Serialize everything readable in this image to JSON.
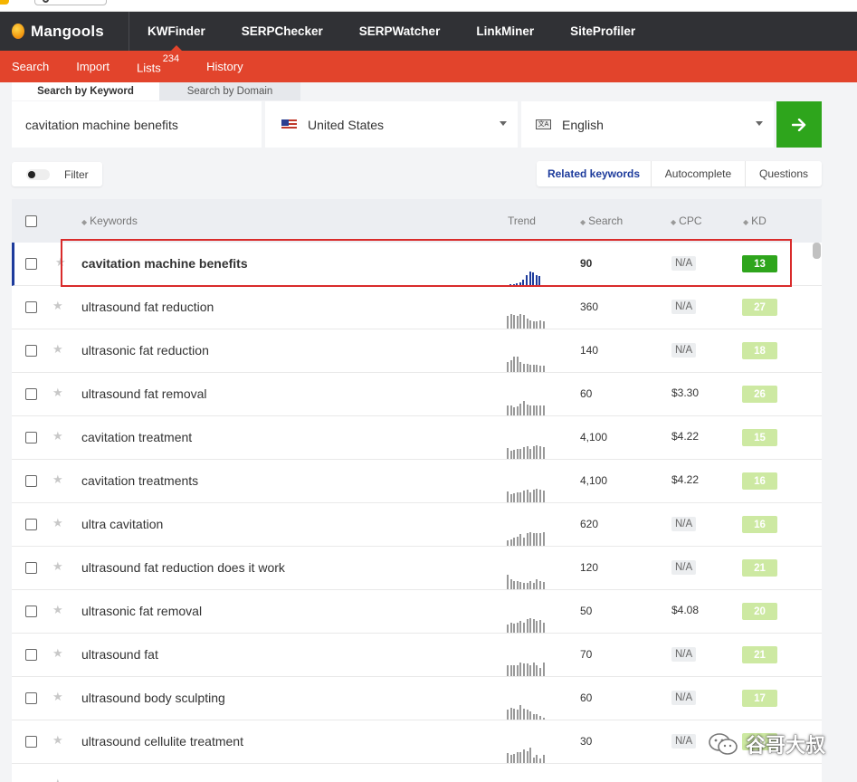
{
  "app": {
    "logo_text": "Mangools",
    "nav": [
      "KWFinder",
      "SERPChecker",
      "SERPWatcher",
      "LinkMiner",
      "SiteProfiler"
    ],
    "active_nav": "KWFinder",
    "accent_color": "#e2442c",
    "dark_color": "#303135"
  },
  "subnav": {
    "search": "Search",
    "import": "Import",
    "lists": "Lists",
    "lists_count": "234",
    "history": "History"
  },
  "search": {
    "tab_keyword": "Search by Keyword",
    "tab_domain": "Search by Domain",
    "query": "cavitation machine benefits",
    "location": "United States",
    "language": "English",
    "language_icon": "translate-icon",
    "go_icon": "arrow-right-icon",
    "go_color": "#2ea51c"
  },
  "filter": {
    "label": "Filter"
  },
  "modes": {
    "related": "Related keywords",
    "autocomplete": "Autocomplete",
    "questions": "Questions"
  },
  "table": {
    "headers": {
      "keywords": "Keywords",
      "trend": "Trend",
      "search": "Search",
      "cpc": "CPC",
      "kd": "KD"
    },
    "rows": [
      {
        "keyword": "cavitation machine benefits",
        "search": "90",
        "cpc": "N/A",
        "kd": "13",
        "kd_color": "#2ea51c",
        "selected": true,
        "trend": [
          0.05,
          0.05,
          0.1,
          0.15,
          0.3,
          0.55,
          0.75,
          0.7,
          0.55,
          0.5
        ]
      },
      {
        "keyword": "ultrasound fat reduction",
        "search": "360",
        "cpc": "N/A",
        "kd": "27",
        "kd_color": "#cde9a2",
        "trend": [
          0.7,
          0.8,
          0.75,
          0.7,
          0.8,
          0.75,
          0.55,
          0.45,
          0.4,
          0.4,
          0.45,
          0.4
        ]
      },
      {
        "keyword": "ultrasonic fat reduction",
        "search": "140",
        "cpc": "N/A",
        "kd": "18",
        "kd_color": "#cde9a2",
        "trend": [
          0.55,
          0.65,
          0.85,
          0.85,
          0.55,
          0.45,
          0.45,
          0.4,
          0.4,
          0.4,
          0.35,
          0.35
        ]
      },
      {
        "keyword": "ultrasound fat removal",
        "search": "60",
        "cpc": "$3.30",
        "kd": "26",
        "kd_color": "#cde9a2",
        "trend": [
          0.55,
          0.55,
          0.45,
          0.5,
          0.65,
          0.8,
          0.6,
          0.55,
          0.55,
          0.55,
          0.55,
          0.55
        ]
      },
      {
        "keyword": "cavitation treatment",
        "search": "4,100",
        "cpc": "$4.22",
        "kd": "15",
        "kd_color": "#cde9a2",
        "trend": [
          0.6,
          0.45,
          0.5,
          0.55,
          0.55,
          0.65,
          0.7,
          0.55,
          0.7,
          0.75,
          0.7,
          0.65
        ]
      },
      {
        "keyword": "cavitation treatments",
        "search": "4,100",
        "cpc": "$4.22",
        "kd": "16",
        "kd_color": "#cde9a2",
        "trend": [
          0.6,
          0.45,
          0.5,
          0.55,
          0.55,
          0.65,
          0.7,
          0.55,
          0.7,
          0.75,
          0.7,
          0.65
        ]
      },
      {
        "keyword": "ultra cavitation",
        "search": "620",
        "cpc": "N/A",
        "kd": "16",
        "kd_color": "#cde9a2",
        "trend": [
          0.3,
          0.35,
          0.45,
          0.5,
          0.65,
          0.45,
          0.7,
          0.75,
          0.7,
          0.7,
          0.7,
          0.75
        ]
      },
      {
        "keyword": "ultrasound fat reduction does it work",
        "search": "120",
        "cpc": "N/A",
        "kd": "21",
        "kd_color": "#cde9a2",
        "trend": [
          0.8,
          0.55,
          0.45,
          0.45,
          0.4,
          0.35,
          0.35,
          0.45,
          0.35,
          0.55,
          0.45,
          0.4
        ]
      },
      {
        "keyword": "ultrasonic fat removal",
        "search": "50",
        "cpc": "$4.08",
        "kd": "20",
        "kd_color": "#cde9a2",
        "trend": [
          0.45,
          0.55,
          0.5,
          0.55,
          0.65,
          0.55,
          0.75,
          0.8,
          0.75,
          0.65,
          0.7,
          0.55
        ]
      },
      {
        "keyword": "ultrasound fat",
        "search": "70",
        "cpc": "N/A",
        "kd": "21",
        "kd_color": "#cde9a2",
        "trend": [
          0.6,
          0.6,
          0.6,
          0.6,
          0.75,
          0.7,
          0.7,
          0.6,
          0.75,
          0.6,
          0.45,
          0.75
        ]
      },
      {
        "keyword": "ultrasound body sculpting",
        "search": "60",
        "cpc": "N/A",
        "kd": "17",
        "kd_color": "#cde9a2",
        "trend": [
          0.55,
          0.65,
          0.6,
          0.55,
          0.8,
          0.6,
          0.55,
          0.45,
          0.3,
          0.3,
          0.2,
          0.1
        ]
      },
      {
        "keyword": "ultrasound cellulite treatment",
        "search": "30",
        "cpc": "N/A",
        "kd": "16",
        "kd_color": "#cde9a2",
        "trend": [
          0.55,
          0.45,
          0.5,
          0.6,
          0.6,
          0.75,
          0.65,
          0.85,
          0.3,
          0.45,
          0.25,
          0.45
        ]
      },
      {
        "keyword": "",
        "search": "",
        "cpc": "",
        "kd": "",
        "kd_color": "#cde9a2",
        "trend": []
      }
    ]
  },
  "watermark": {
    "text": "谷哥大叔",
    "icon": "wechat-icon"
  }
}
